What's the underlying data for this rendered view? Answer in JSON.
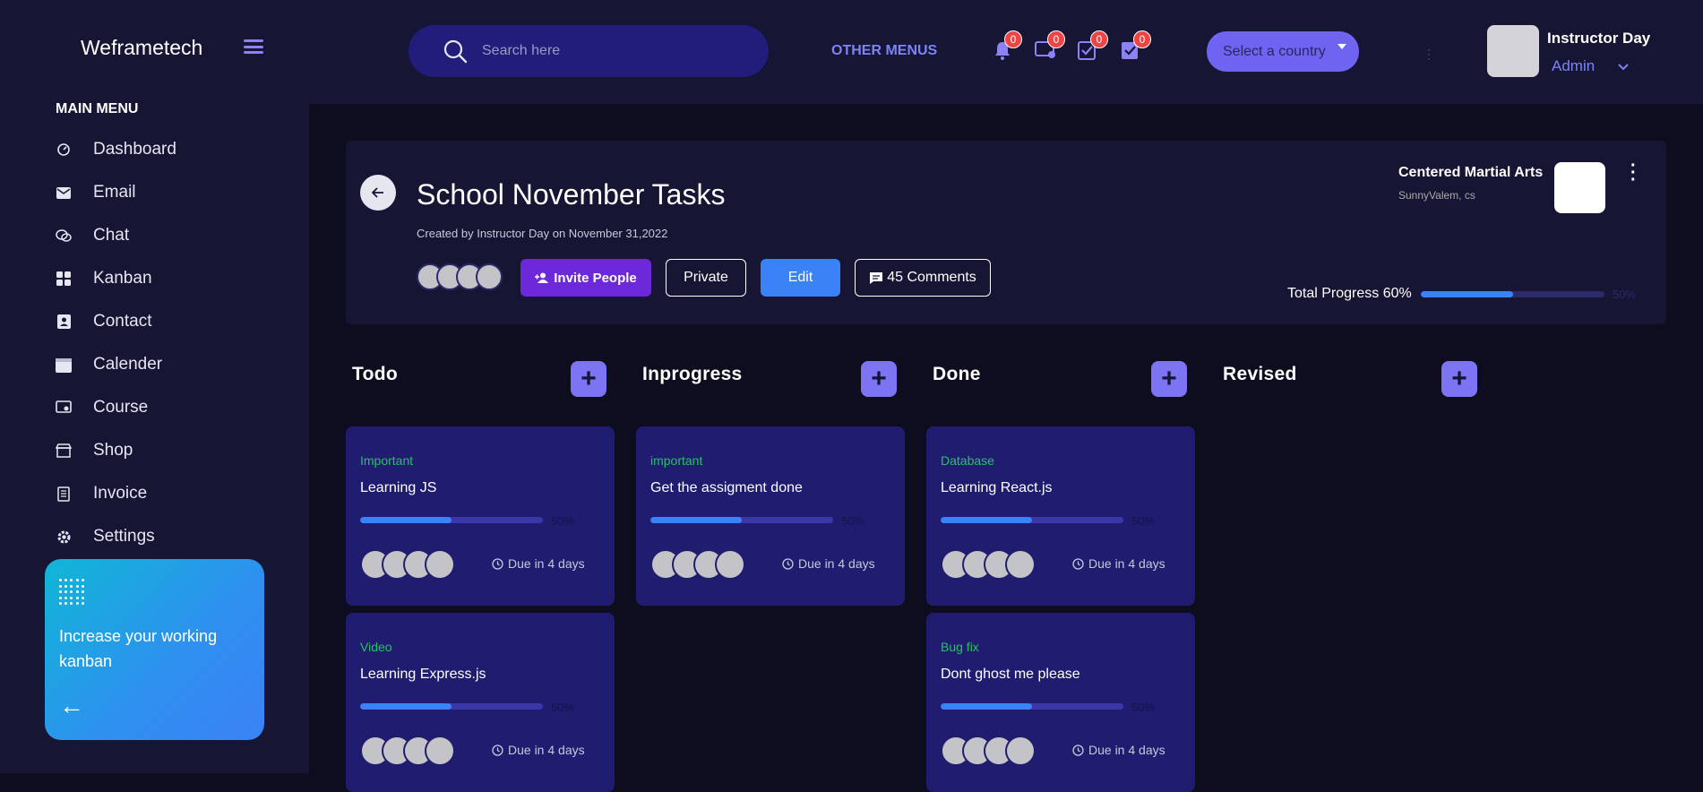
{
  "brand": "Weframetech",
  "sidebar": {
    "menu_title": "MAIN MENU",
    "items": [
      {
        "label": "Dashboard",
        "icon": "dashboard-icon"
      },
      {
        "label": "Email",
        "icon": "email-icon"
      },
      {
        "label": "Chat",
        "icon": "chat-icon"
      },
      {
        "label": "Kanban",
        "icon": "kanban-icon"
      },
      {
        "label": "Contact",
        "icon": "contact-icon"
      },
      {
        "label": "Calender",
        "icon": "calendar-icon"
      },
      {
        "label": "Course",
        "icon": "course-icon"
      },
      {
        "label": "Shop",
        "icon": "shop-icon"
      },
      {
        "label": "Invoice",
        "icon": "invoice-icon"
      },
      {
        "label": "Settings",
        "icon": "settings-icon"
      }
    ],
    "promo": {
      "text": "Increase your working kanban",
      "arrow": "←"
    }
  },
  "topbar": {
    "search_placeholder": "Search here",
    "other_menus": "OTHER MENUS",
    "notifications": [
      {
        "icon": "bell-icon",
        "count": "0"
      },
      {
        "icon": "chat-user-icon",
        "count": "0"
      },
      {
        "icon": "task-icon",
        "count": "0"
      },
      {
        "icon": "checklist-icon",
        "count": "0"
      }
    ],
    "country_select": "Select a country",
    "user": {
      "name": "Instructor Day",
      "role": "Admin"
    }
  },
  "project": {
    "title": "School November Tasks",
    "created": "Created by Instructor Day on November 31,2022",
    "buttons": {
      "invite": "Invite People",
      "private": "Private",
      "edit": "Edit",
      "comments": "45 Comments"
    },
    "org": {
      "name": "Centered Martial Arts",
      "location": "SunnyValem, cs"
    },
    "progress": {
      "label": "Total Progress 60%",
      "value": 50,
      "value_text": "50%"
    }
  },
  "columns": [
    {
      "title": "Todo"
    },
    {
      "title": "Inprogress"
    },
    {
      "title": "Done"
    },
    {
      "title": "Revised"
    }
  ],
  "cards": [
    {
      "col": 0,
      "tag": "Important",
      "title": "Learning JS",
      "progress": 50,
      "pct": "50%",
      "due": "Due in 4 days"
    },
    {
      "col": 0,
      "tag": "Video",
      "title": "Learning Express.js",
      "progress": 50,
      "pct": "50%",
      "due": "Due in 4 days"
    },
    {
      "col": 1,
      "tag": "important",
      "title": "Get the assigment done",
      "progress": 50,
      "pct": "50%",
      "due": "Due in 4 days"
    },
    {
      "col": 2,
      "tag": "Database",
      "title": "Learning React.js",
      "progress": 50,
      "pct": "50%",
      "due": "Due in 4 days"
    },
    {
      "col": 2,
      "tag": "Bug fix",
      "title": "Dont ghost me please",
      "progress": 50,
      "pct": "50%",
      "due": "Due in 4 days"
    }
  ]
}
